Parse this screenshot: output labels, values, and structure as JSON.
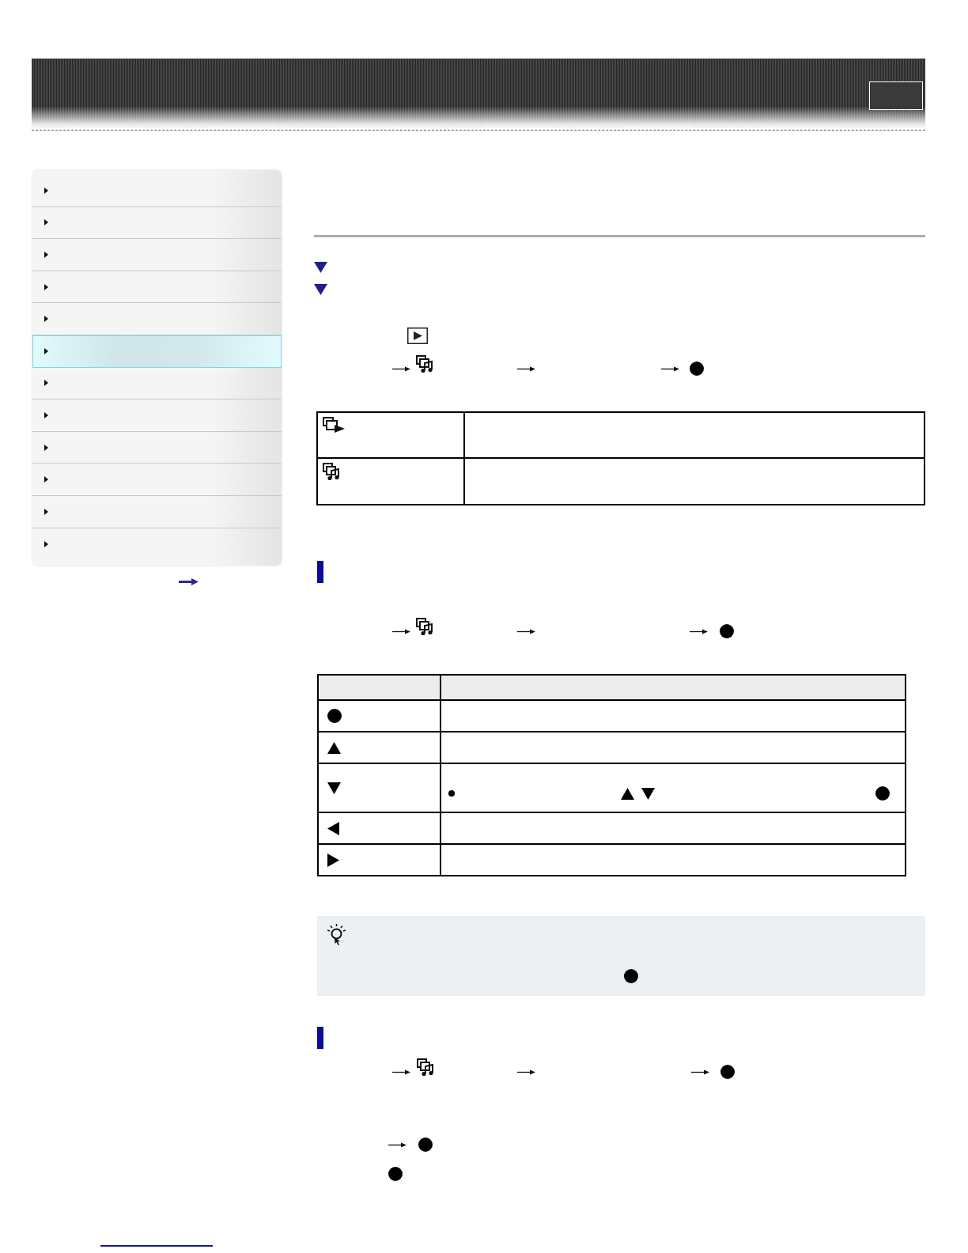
{
  "sidebar": {
    "items": [
      {
        "selected": false
      },
      {
        "selected": false
      },
      {
        "selected": false
      },
      {
        "selected": false
      },
      {
        "selected": false
      },
      {
        "selected": true
      },
      {
        "selected": false
      },
      {
        "selected": false
      },
      {
        "selected": false
      },
      {
        "selected": false
      },
      {
        "selected": false
      },
      {
        "selected": false
      }
    ]
  }
}
